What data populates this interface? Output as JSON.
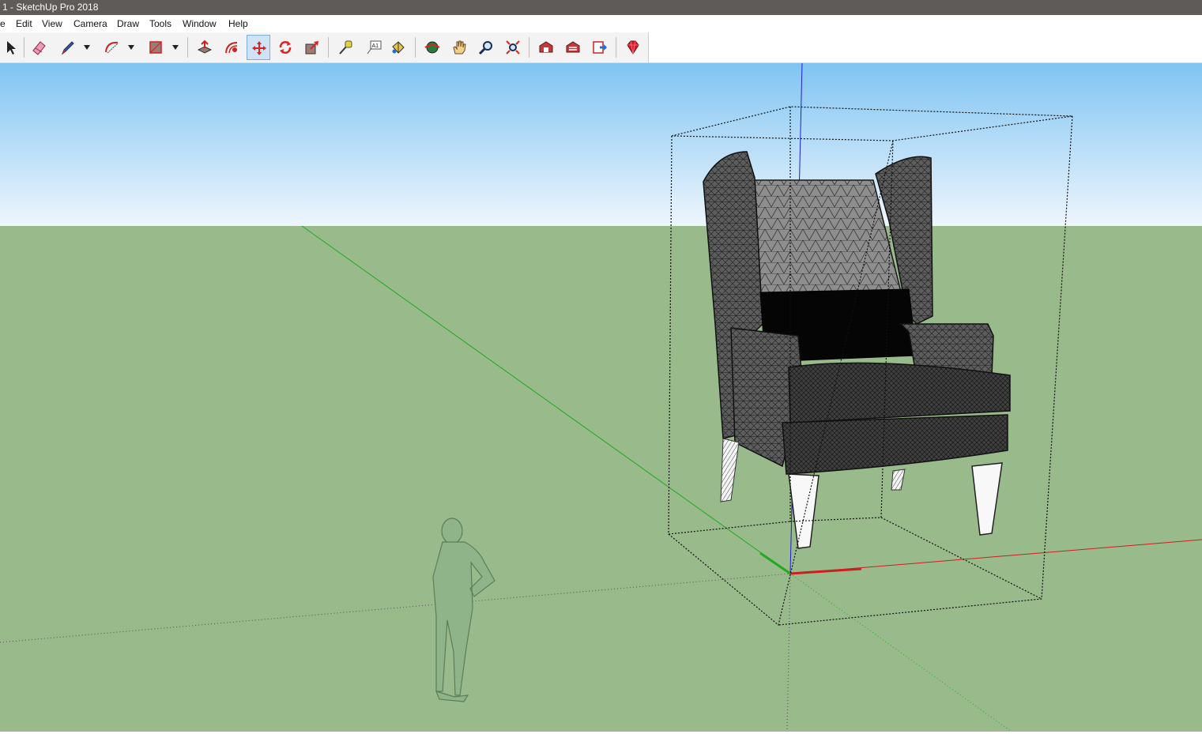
{
  "window": {
    "title": "1 - SketchUp Pro 2018"
  },
  "menu": [
    "e",
    "Edit",
    "View",
    "Camera",
    "Draw",
    "Tools",
    "Window",
    "Help"
  ],
  "toolbar": {
    "tools": [
      {
        "name": "select-tool-button",
        "icon": "arrow-cursor-icon",
        "active": false
      },
      {
        "name": "eraser-tool-button",
        "icon": "eraser-icon",
        "active": false
      },
      {
        "name": "line-tool-button",
        "icon": "pencil-icon",
        "active": false
      },
      {
        "name": "arc-tool-button",
        "icon": "arc-icon",
        "active": false
      },
      {
        "name": "rectangle-tool-button",
        "icon": "rectangle-icon",
        "active": false
      },
      {
        "name": "push-pull-tool-button",
        "icon": "push-pull-icon",
        "active": false
      },
      {
        "name": "offset-tool-button",
        "icon": "offset-icon",
        "active": false
      },
      {
        "name": "move-tool-button",
        "icon": "move-icon",
        "active": true
      },
      {
        "name": "rotate-tool-button",
        "icon": "rotate-icon",
        "active": false
      },
      {
        "name": "scale-tool-button",
        "icon": "scale-icon",
        "active": false
      },
      {
        "name": "tape-measure-tool-button",
        "icon": "tape-measure-icon",
        "active": false
      },
      {
        "name": "text-tool-button",
        "icon": "text-icon",
        "active": false
      },
      {
        "name": "paint-bucket-tool-button",
        "icon": "paint-bucket-icon",
        "active": false
      },
      {
        "name": "orbit-tool-button",
        "icon": "orbit-icon",
        "active": false
      },
      {
        "name": "pan-tool-button",
        "icon": "hand-icon",
        "active": false
      },
      {
        "name": "zoom-tool-button",
        "icon": "magnifier-icon",
        "active": false
      },
      {
        "name": "zoom-extents-button",
        "icon": "zoom-extents-icon",
        "active": false
      },
      {
        "name": "warehouse-button",
        "icon": "warehouse-icon",
        "active": false
      },
      {
        "name": "extension-warehouse-button",
        "icon": "extension-warehouse-icon",
        "active": false
      },
      {
        "name": "send-to-layout-button",
        "icon": "layout-icon",
        "active": false
      },
      {
        "name": "ruby-console-button",
        "icon": "ruby-gem-icon",
        "active": false
      }
    ],
    "text_tool_label": "A1"
  },
  "colors": {
    "sky_top": "#7fc4f2",
    "sky_bottom": "#eef6fd",
    "ground": "#99ba8b",
    "axis_red": "#cc1f1f",
    "axis_green": "#1faa1f",
    "axis_blue": "#1f1fcc",
    "active_tool": "#cfe3f7"
  }
}
